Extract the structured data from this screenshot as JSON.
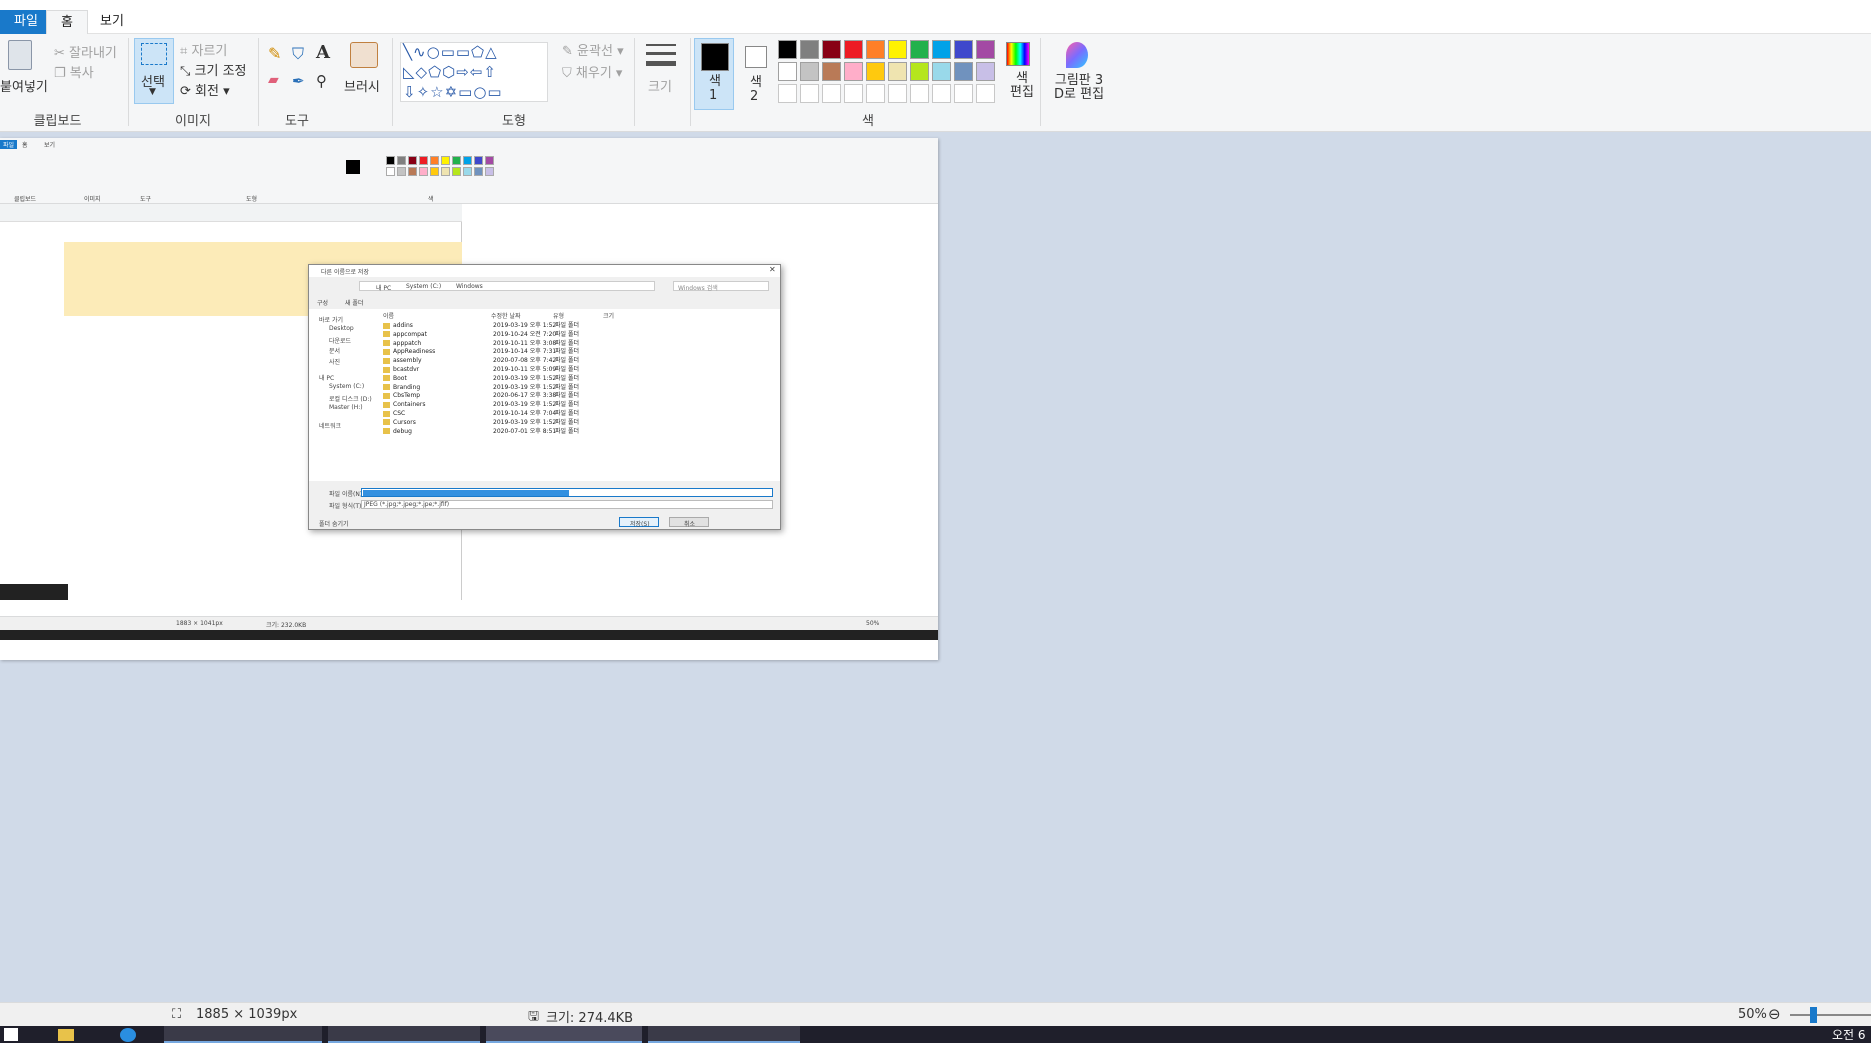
{
  "menu": {
    "file": "파일",
    "home": "홈",
    "view": "보기"
  },
  "clipboard": {
    "paste": "붙여넣기",
    "cut": "잘라내기",
    "copy": "복사",
    "label": "클립보드"
  },
  "image_group": {
    "select": "선택",
    "crop": "자르기",
    "resize": "크기 조정",
    "rotate": "회전",
    "label": "이미지"
  },
  "tools": {
    "label": "도구"
  },
  "brushes": {
    "label": "브러시"
  },
  "shapes": {
    "outline": "윤곽선",
    "fill": "채우기",
    "label": "도형"
  },
  "size": {
    "label": "크기"
  },
  "colors": {
    "color1": "색\n1",
    "color2": "색\n2",
    "label": "색",
    "edit": "색\n편집",
    "paint3d": "그림판 3\nD로 편집",
    "row1": [
      "#000000",
      "#7f7f7f",
      "#880015",
      "#ed1c24",
      "#ff7f27",
      "#fff200",
      "#22b14c",
      "#00a2e8",
      "#3f48cc",
      "#a349a4"
    ],
    "row2": [
      "#ffffff",
      "#c3c3c3",
      "#b97a57",
      "#ffaec9",
      "#ffc90e",
      "#efe4b0",
      "#b5e61d",
      "#99d9ea",
      "#7092be",
      "#c8bfe7"
    ]
  },
  "status": {
    "dimensions": "1885 × 1039px",
    "size": "크기: 274.4KB",
    "zoom": "50%"
  },
  "taskbar": {
    "time": "오전 6"
  },
  "inner": {
    "dialog_title": "다른 이름으로 저장",
    "path": [
      "내 PC",
      "System (C:)",
      "Windows"
    ],
    "search_placeholder": "Windows 검색",
    "organize": "구성",
    "new_folder": "새 폴더",
    "nav": [
      "바로 가기",
      "Desktop",
      "다운로드",
      "문서",
      "사진",
      "내 PC",
      "System (C:)",
      "로컬 디스크 (D:)",
      "Master (H:)",
      "네트워크"
    ],
    "columns": [
      "이름",
      "수정한 날짜",
      "유형",
      "크기"
    ],
    "files": [
      {
        "name": "addins",
        "date": "2019-03-19 오후 1:52",
        "type": "파일 폴더"
      },
      {
        "name": "appcompat",
        "date": "2019-10-24 오전 7:20",
        "type": "파일 폴더"
      },
      {
        "name": "apppatch",
        "date": "2019-10-11 오후 3:08",
        "type": "파일 폴더"
      },
      {
        "name": "AppReadiness",
        "date": "2019-10-14 오후 7:31",
        "type": "파일 폴더"
      },
      {
        "name": "assembly",
        "date": "2020-07-08 오후 7:42",
        "type": "파일 폴더"
      },
      {
        "name": "bcastdvr",
        "date": "2019-10-11 오후 5:09",
        "type": "파일 폴더"
      },
      {
        "name": "Boot",
        "date": "2019-03-19 오후 1:52",
        "type": "파일 폴더"
      },
      {
        "name": "Branding",
        "date": "2019-03-19 오후 1:52",
        "type": "파일 폴더"
      },
      {
        "name": "CbsTemp",
        "date": "2020-06-17 오후 3:38",
        "type": "파일 폴더"
      },
      {
        "name": "Containers",
        "date": "2019-03-19 오후 1:52",
        "type": "파일 폴더"
      },
      {
        "name": "CSC",
        "date": "2019-10-14 오후 7:04",
        "type": "파일 폴더"
      },
      {
        "name": "Cursors",
        "date": "2019-03-19 오후 1:52",
        "type": "파일 폴더"
      },
      {
        "name": "debug",
        "date": "2020-07-01 오후 8:51",
        "type": "파일 폴더"
      }
    ],
    "filename_label": "파일 이름(N):",
    "filetype_label": "파일 형식(T):",
    "filetype": "JPEG (*.jpg;*.jpeg;*.jpe;*.jfif)",
    "save": "저장(S)",
    "cancel": "취소",
    "hide_folders": "폴더 숨기기",
    "status_dims": "1883 × 1041px",
    "status_size": "크기: 232.0KB",
    "zoom": "50%"
  }
}
